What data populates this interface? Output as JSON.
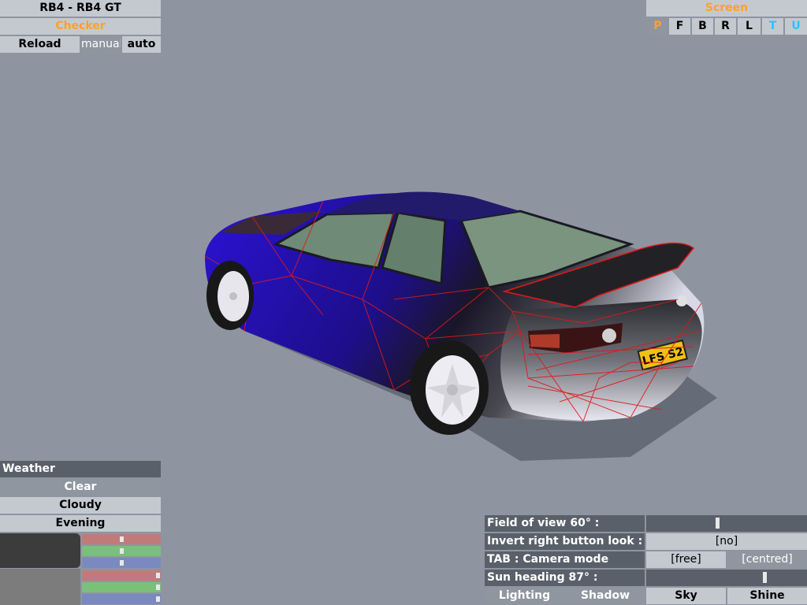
{
  "car": {
    "title": "RB4 - RB4 GT",
    "skin": "Checker"
  },
  "reload": {
    "reload": "Reload",
    "manual": "manual",
    "auto": "auto"
  },
  "screen": {
    "title": "Screen",
    "buttons": [
      "P",
      "F",
      "B",
      "R",
      "L",
      "T",
      "U"
    ]
  },
  "car_view": {
    "plate": "LFS S2"
  },
  "weather": {
    "title": "Weather",
    "options": [
      "Clear",
      "Cloudy",
      "Evening"
    ]
  },
  "settings": {
    "fov_label": "Field of view 60° :",
    "invert_label": "Invert right button look :",
    "invert_value": "[no]",
    "tab_label": "TAB : Camera mode",
    "free": "[free]",
    "centred": "[centred]",
    "sun_label": "Sun heading 87° :",
    "tabs": [
      "Lighting",
      "Shadow",
      "Sky",
      "Shine"
    ]
  },
  "colors": {
    "accent_orange": "#ffa126",
    "accent_cyan": "#29c4ff",
    "background": "#8e95a1",
    "car_body": "#2a14c8",
    "wireframe": "#e01818"
  },
  "light_levels": {
    "ambient": [
      0.5,
      0.5,
      0.5
    ],
    "directional": [
      0.98,
      0.98,
      0.98
    ]
  }
}
